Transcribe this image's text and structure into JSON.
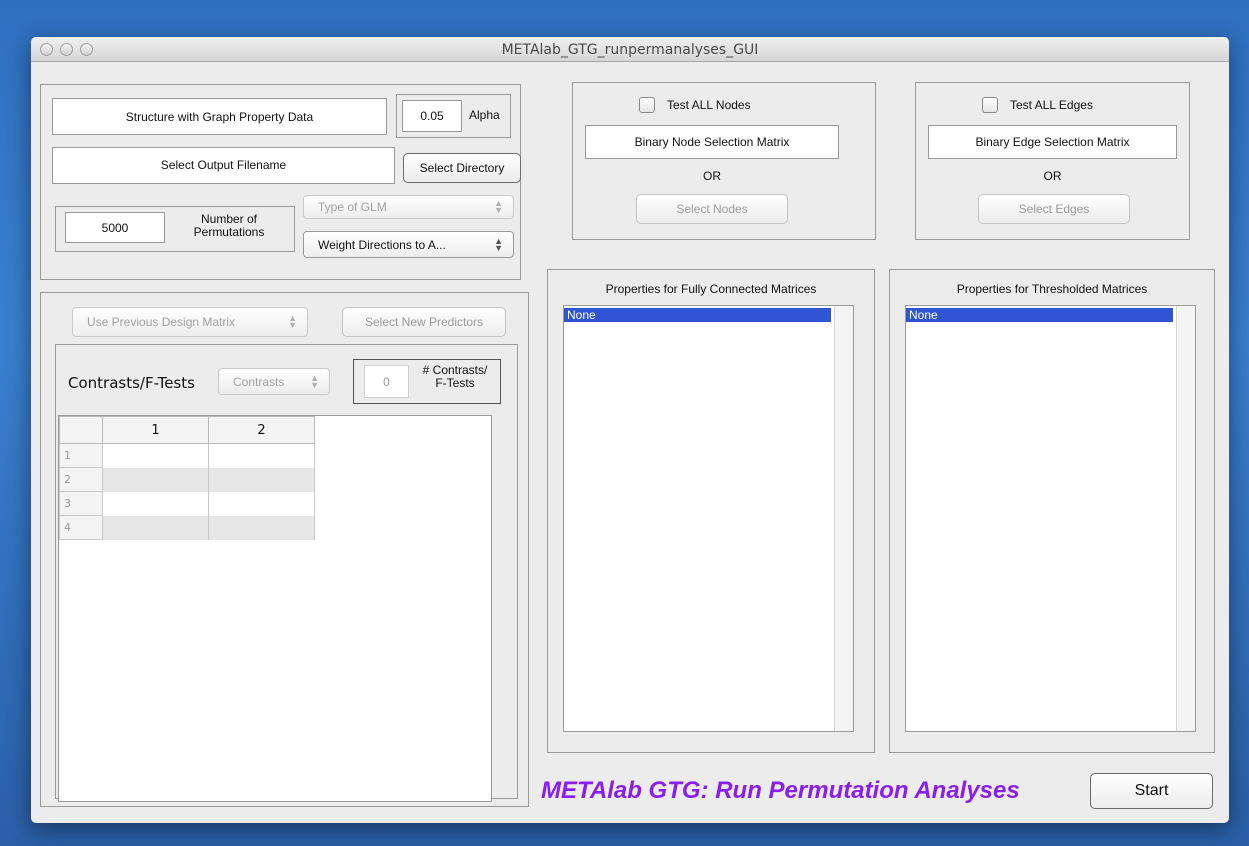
{
  "window": {
    "title": "METAlab_GTG_runpermanalyses_GUI"
  },
  "top_left": {
    "structure_field": "Structure with Graph Property Data",
    "alpha_value": "0.05",
    "alpha_label": "Alpha",
    "output_field": "Select Output Filename",
    "select_directory": "Select Directory",
    "permutations_value": "5000",
    "permutations_label_1": "Number of",
    "permutations_label_2": "Permutations",
    "glm_popup": "Type of GLM",
    "weight_popup": "Weight Directions to A..."
  },
  "design": {
    "design_popup": "Use Previous Design Matrix",
    "select_predictors": "Select New Predictors",
    "contrasts_label": "Contrasts/F-Tests",
    "contrasts_popup": "Contrasts",
    "num_contrasts_value": "0",
    "num_contrasts_label_1": "# Contrasts/",
    "num_contrasts_label_2": "F-Tests",
    "table": {
      "columns": [
        "1",
        "2"
      ],
      "rows": [
        "1",
        "2",
        "3",
        "4"
      ]
    }
  },
  "nodes": {
    "test_all": "Test ALL Nodes",
    "selection_field": "Binary Node Selection Matrix",
    "or": "OR",
    "select_button": "Select Nodes"
  },
  "edges": {
    "test_all": "Test ALL Edges",
    "selection_field": "Binary Edge Selection Matrix",
    "or": "OR",
    "select_button": "Select Edges"
  },
  "fully_connected": {
    "title": "Properties for Fully Connected Matrices",
    "items": [
      "None"
    ]
  },
  "thresholded": {
    "title": "Properties for Thresholded Matrices",
    "items": [
      "None"
    ]
  },
  "footer": {
    "banner": "METAlab GTG: Run Permutation Analyses",
    "start": "Start"
  },
  "colors": {
    "banner": "#8a1ef0",
    "selection": "#2f55d4",
    "desktop": "#3a7fd0"
  }
}
